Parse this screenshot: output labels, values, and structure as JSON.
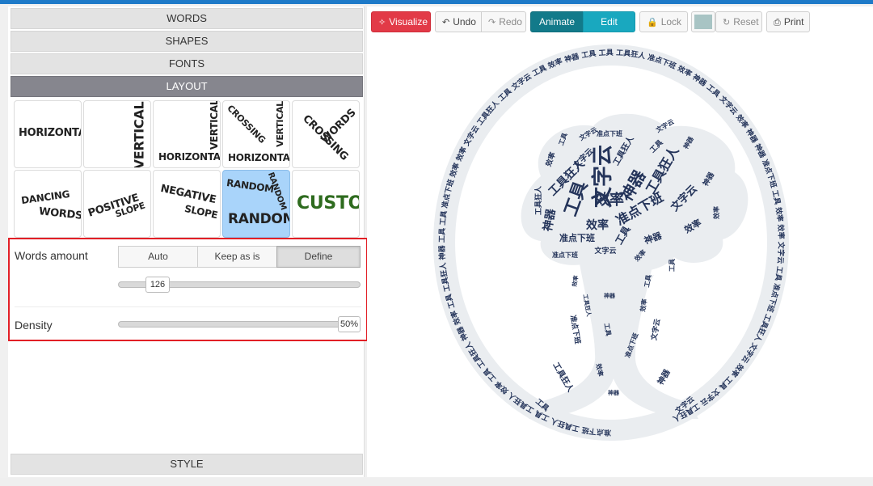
{
  "accordion": {
    "words": "WORDS",
    "shapes": "SHAPES",
    "fonts": "FONTS",
    "layout": "LAYOUT",
    "style": "STYLE"
  },
  "layouts": [
    "Horizontal",
    "Vertical",
    "Vertical Horizontal",
    "Crossing Vertical Horizontal",
    "Crossing Words",
    "Dancing Words",
    "Positive Slope",
    "Negative Slope",
    "Random Random Random",
    "Custom"
  ],
  "selected_layout": "Random Random Random",
  "words_amount": {
    "label": "Words amount",
    "options": [
      "Auto",
      "Keep as is",
      "Define"
    ],
    "selected": "Define",
    "value": "126"
  },
  "density": {
    "label": "Density",
    "value": "50%"
  },
  "toolbar": {
    "visualize": "Visualize",
    "undo": "Undo",
    "redo": "Redo",
    "animate": "Animate",
    "edit": "Edit",
    "lock": "Lock",
    "reset": "Reset",
    "print": "Print"
  },
  "colors": {
    "accent_blue": "#1e7ac8",
    "visualize_red": "#e23a47",
    "highlight_border": "#e21f26",
    "selected_tile": "#a9d4fa",
    "animate_teal": "#127a8a",
    "edit_teal": "#19a8bf",
    "cloud_shape": "#eaedf0",
    "word_color": "#24345a",
    "swatch": "#a8c4c4"
  },
  "wordcloud": {
    "tree_words": [
      "文字云",
      "工具",
      "神器",
      "效率",
      "工具狂人",
      "准点下班",
      "工具狂人",
      "神器",
      "效率",
      "文字云",
      "工具",
      "准点下班",
      "神器",
      "效率",
      "文字云",
      "工具狂人",
      "工具",
      "效率",
      "神器",
      "文字云",
      "准点下班",
      "工具",
      "工具狂人",
      "效率",
      "文字云",
      "神器",
      "工具",
      "效率",
      "准点下班",
      "文字云"
    ],
    "ring_words": [
      "准点下班",
      "工具狂人",
      "工具",
      "工具狂人",
      "效率",
      "工具",
      "工具狂人",
      "神器",
      "效率",
      "工具",
      "工具狂人",
      "神器",
      "工具",
      "工具",
      "准点下班",
      "效率",
      "效率",
      "文字云",
      "工具狂人",
      "工具",
      "文字云",
      "工具",
      "效率",
      "神器",
      "工具",
      "工具",
      "工具狂人",
      "准点下班",
      "效率",
      "神器",
      "工具",
      "文字云",
      "效率",
      "神器",
      "神器",
      "准点下班",
      "工具",
      "效率",
      "效率",
      "文字云",
      "工具",
      "准点下班",
      "工具狂人",
      "文字云",
      "效率",
      "工具",
      "文字云",
      "工具狂人"
    ],
    "trunk_words": [
      "准点下班",
      "工具狂人",
      "神器",
      "效率",
      "文字云",
      "工具",
      "准点下班",
      "工具狂人",
      "神器",
      "效率",
      "工具",
      "文字云",
      "效率",
      "工具",
      "神器"
    ]
  }
}
